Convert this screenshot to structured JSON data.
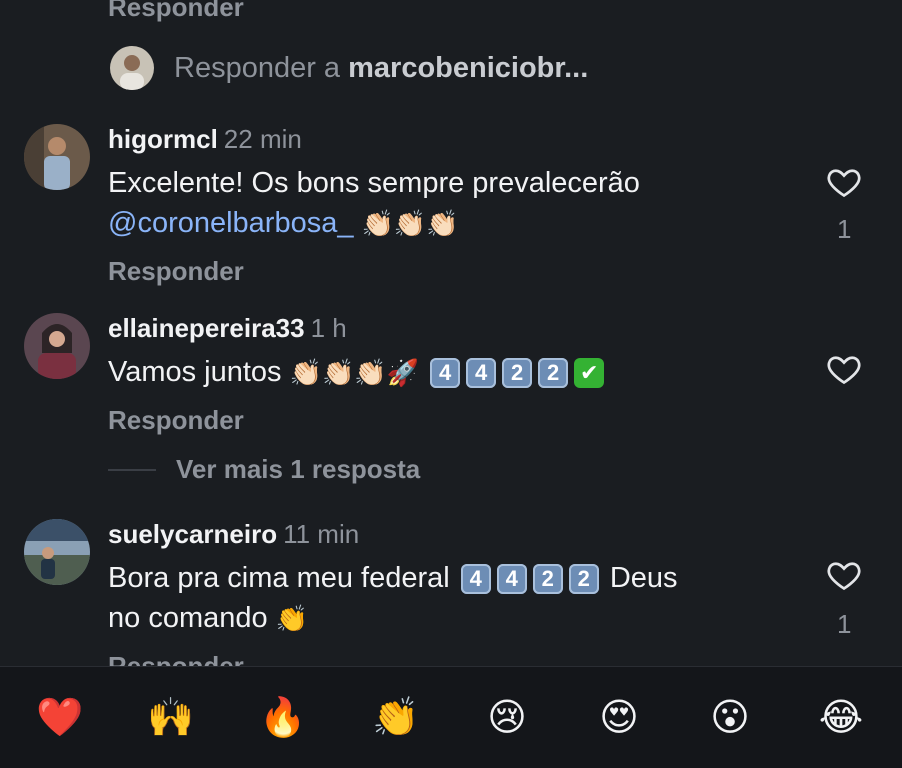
{
  "top_reply_label": "Responder",
  "reply_to": {
    "prefix": "Responder a",
    "username": "marcobeniciobr..."
  },
  "comments": [
    {
      "username": "higormcl",
      "time": "22 min",
      "text_line1": "Excelente! Os bons sempre prevalecerão",
      "mention": "@coronelbarbosa_",
      "emojis": "👏🏻👏🏻👏🏻",
      "reply_label": "Responder",
      "likes": "1"
    },
    {
      "username": "ellainepereira33",
      "time": "1 h",
      "text_start": "Vamos juntos",
      "emojis": "👏🏻👏🏻👏🏻🚀",
      "digits": [
        "4",
        "4",
        "2",
        "2"
      ],
      "check": "✔",
      "reply_label": "Responder"
    },
    {
      "username": "suelycarneiro",
      "time": "11 min",
      "text_start": "Bora pra cima meu federal",
      "digits": [
        "4",
        "4",
        "2",
        "2"
      ],
      "text_end": "Deus",
      "text_line2": "no comando",
      "emoji_end": "👏",
      "reply_label": "Responder",
      "likes": "1"
    }
  ],
  "view_more": "Ver mais 1 resposta",
  "reactions": [
    {
      "name": "heart",
      "glyph": "❤️"
    },
    {
      "name": "raised-hands",
      "glyph": "🙌"
    },
    {
      "name": "fire",
      "glyph": "🔥"
    },
    {
      "name": "clap",
      "glyph": "👏"
    },
    {
      "name": "crying",
      "glyph": "😢"
    },
    {
      "name": "heart-eyes",
      "glyph": "😍"
    },
    {
      "name": "surprised",
      "glyph": "😮"
    },
    {
      "name": "laughing",
      "glyph": "😂"
    }
  ],
  "colors": {
    "background": "#1a1d21",
    "mention": "#8ab4f8",
    "muted": "#8e939b"
  }
}
